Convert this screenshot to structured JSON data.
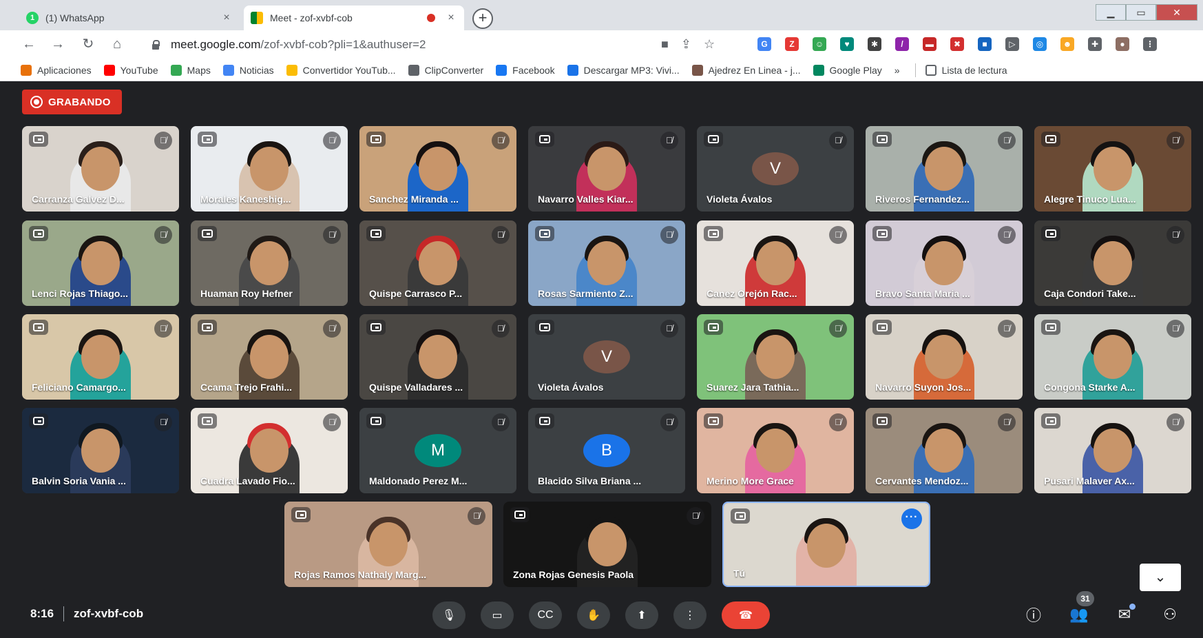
{
  "browser": {
    "tabs": [
      {
        "favicon_text": "1",
        "title": "(1) WhatsApp",
        "close": "×",
        "active": false
      },
      {
        "title": "Meet - zof-xvbf-cob",
        "close": "×",
        "active": true
      }
    ],
    "new_tab": "+",
    "window_controls": {
      "minimize": "▁",
      "maximize": "▭",
      "close": "✕"
    },
    "nav": {
      "back": "←",
      "forward": "→",
      "reload": "↻",
      "home": "⌂"
    },
    "url_host": "meet.google.com",
    "url_rest": "/zof-xvbf-cob?pli=1&authuser=2",
    "omni_icons": {
      "camera": "■",
      "share": "⇪",
      "star": "☆"
    },
    "extension_icons": [
      {
        "name": "ext-1",
        "text": "G",
        "color": "#4285f4"
      },
      {
        "name": "ext-2",
        "text": "Z",
        "color": "#e53935"
      },
      {
        "name": "ext-3",
        "text": "☺",
        "color": "#34a853"
      },
      {
        "name": "ext-4",
        "text": "♥",
        "color": "#00897b"
      },
      {
        "name": "ext-5",
        "text": "✱",
        "color": "#424242"
      },
      {
        "name": "ext-6",
        "text": "/",
        "color": "#8e24aa"
      },
      {
        "name": "ext-7",
        "text": "▬",
        "color": "#c62828"
      },
      {
        "name": "ext-8",
        "text": "✖",
        "color": "#d32f2f"
      },
      {
        "name": "ext-9",
        "text": "■",
        "color": "#1565c0"
      },
      {
        "name": "ext-10",
        "text": "▷",
        "color": "#5f6368"
      },
      {
        "name": "ext-11",
        "text": "◎",
        "color": "#1e88e5"
      },
      {
        "name": "ext-12",
        "text": "☻",
        "color": "#f9a825"
      },
      {
        "name": "ext-13",
        "text": "✚",
        "color": "#5f6368"
      },
      {
        "name": "ext-14",
        "text": "●",
        "color": "#8d6e63"
      },
      {
        "name": "ext-15",
        "text": "⋮",
        "color": "#5f6368"
      }
    ],
    "bookmarks": [
      {
        "label": "Aplicaciones",
        "color": "#e8710a"
      },
      {
        "label": "YouTube",
        "color": "#ff0000"
      },
      {
        "label": "Maps",
        "color": "#34a853"
      },
      {
        "label": "Noticias",
        "color": "#4285f4"
      },
      {
        "label": "Convertidor YouTub...",
        "color": "#fbbc04"
      },
      {
        "label": "ClipConverter",
        "color": "#5f6368"
      },
      {
        "label": "Facebook",
        "color": "#1877f2"
      },
      {
        "label": "Descargar MP3: Vivi...",
        "color": "#1a73e8"
      },
      {
        "label": "Ajedrez En Linea - j...",
        "color": "#795548"
      },
      {
        "label": "Google Play",
        "color": "#01875f"
      }
    ],
    "bookmarks_overflow": "»",
    "reading_list": "Lista de lectura"
  },
  "meet": {
    "recording_label": "GRABANDO",
    "participants": [
      {
        "name": "Carranza Galvez D...",
        "kind": "video",
        "muted": true,
        "bg": "#d9d3cc",
        "shirt": "#e8e8e8",
        "hair": "#2a1f1a"
      },
      {
        "name": "Morales Kaneshig...",
        "kind": "video",
        "muted": true,
        "bg": "#e9ecef",
        "shirt": "#d8c3b0",
        "hair": "#1a1512"
      },
      {
        "name": "Sanchez Miranda ...",
        "kind": "video",
        "muted": true,
        "bg": "#c9a27a",
        "shirt": "#1c66c8",
        "hair": "#151010"
      },
      {
        "name": "Navarro Valles Kiar...",
        "kind": "video",
        "muted": true,
        "bg": "#3a3b3e",
        "shirt": "#c2305a",
        "hair": "#2b1a16"
      },
      {
        "name": "Violeta Ávalos",
        "kind": "avatar",
        "letter": "V",
        "muted": true,
        "color": "#795548"
      },
      {
        "name": "Riveros Fernandez...",
        "kind": "video",
        "muted": true,
        "bg": "#a9b0aa",
        "shirt": "#3a6fb5",
        "hair": "#1b1713"
      },
      {
        "name": "Alegre Tinuco Lua...",
        "kind": "video",
        "muted": true,
        "bg": "#6a4a34",
        "shirt": "#b0d9c0",
        "hair": "#141212"
      },
      {
        "name": "Lenci Rojas Thiago...",
        "kind": "video",
        "muted": true,
        "bg": "#9aa88a",
        "shirt": "#2a4a8a",
        "hair": "#1a1512"
      },
      {
        "name": "Huaman Roy Hefner",
        "kind": "video",
        "muted": true,
        "bg": "#6e6a62",
        "shirt": "#4a4a4a",
        "hair": "#201a16"
      },
      {
        "name": "Quispe Carrasco P...",
        "kind": "video",
        "muted": true,
        "bg": "#56504a",
        "shirt": "#3a3a3a",
        "hair": "#c62828"
      },
      {
        "name": "Rosas Sarmiento Z...",
        "kind": "video",
        "muted": true,
        "bg": "#8aa6c7",
        "shirt": "#4b87c9",
        "hair": "#1a1512"
      },
      {
        "name": "Canez Orejón Rac...",
        "kind": "video",
        "muted": true,
        "bg": "#e6e1dc",
        "shirt": "#cf3a3a",
        "hair": "#1a1512"
      },
      {
        "name": "Bravo Santa Maria ...",
        "kind": "video",
        "muted": true,
        "bg": "#d2cbd6",
        "shirt": "#d8d0d8",
        "hair": "#141010"
      },
      {
        "name": "Caja Condori Take...",
        "kind": "video",
        "muted": true,
        "bg": "#3b3a38",
        "shirt": "#3a3a3a",
        "hair": "#141010"
      },
      {
        "name": "Feliciano Camargo...",
        "kind": "video",
        "muted": true,
        "bg": "#d8c7a8",
        "shirt": "#24a39b",
        "hair": "#1a1512"
      },
      {
        "name": "Ccama Trejo Frahi...",
        "kind": "video",
        "muted": true,
        "bg": "#b5a58a",
        "shirt": "#5a4a3a",
        "hair": "#181310"
      },
      {
        "name": "Quispe Valladares ...",
        "kind": "video",
        "muted": true,
        "bg": "#4a4743",
        "shirt": "#2d2d2d",
        "hair": "#151010"
      },
      {
        "name": "Violeta Ávalos",
        "kind": "avatar",
        "letter": "V",
        "muted": true,
        "color": "#795548"
      },
      {
        "name": "Suarez Jara Tathia...",
        "kind": "video",
        "muted": true,
        "bg": "#7fc27a",
        "shirt": "#7a6a5a",
        "hair": "#1a1512"
      },
      {
        "name": "Navarro Suyon Jos...",
        "kind": "video",
        "muted": true,
        "bg": "#d8d2c8",
        "shirt": "#d66a3a",
        "hair": "#161210"
      },
      {
        "name": "Congona Starke A...",
        "kind": "video",
        "muted": true,
        "bg": "#c9ccc7",
        "shirt": "#31a29b",
        "hair": "#1a1512"
      },
      {
        "name": "Balvin Soria Vania ...",
        "kind": "video",
        "muted": true,
        "bg": "#1b2a3f",
        "shirt": "#2a3a5a",
        "hair": "#101820"
      },
      {
        "name": "Cuadra Lavado Fio...",
        "kind": "video",
        "muted": true,
        "bg": "#ece7e0",
        "shirt": "#3a3a3a",
        "hair": "#d32f2f"
      },
      {
        "name": "Maldonado Perez M...",
        "kind": "avatar",
        "letter": "M",
        "muted": true,
        "color": "#00897b"
      },
      {
        "name": "Blacido Silva Briana ...",
        "kind": "avatar",
        "letter": "B",
        "muted": true,
        "color": "#1a73e8"
      },
      {
        "name": "Merino More Grace",
        "kind": "video",
        "muted": true,
        "bg": "#e0b5a0",
        "shirt": "#e56aa0",
        "hair": "#1a1512"
      },
      {
        "name": "Cervantes Mendoz...",
        "kind": "video",
        "muted": true,
        "bg": "#9b8c7c",
        "shirt": "#3a6fb5",
        "hair": "#1a1512"
      },
      {
        "name": "Pusari Malaver Ax...",
        "kind": "video",
        "muted": true,
        "bg": "#dcd7d0",
        "shirt": "#4a62a8",
        "hair": "#161210"
      },
      {
        "name": "Rojas Ramos Nathaly Marg...",
        "kind": "video",
        "muted": true,
        "bg": "#b99a84",
        "shirt": "#d8b6a0",
        "hair": "#4a3328"
      },
      {
        "name": "Zona Rojas Genesis Paola",
        "kind": "video",
        "muted": true,
        "bg": "#151515",
        "shirt": "#222222",
        "hair": "#151515"
      },
      {
        "name": "Tú",
        "kind": "self",
        "muted": false,
        "bg": "#dcd8cf",
        "shirt": "#e2b3a8",
        "hair": "#1a1512"
      }
    ],
    "scroll_down": "⌄",
    "time": "8:16",
    "meeting_code": "zof-xvbf-cob",
    "controls": [
      {
        "name": "microphone-button",
        "icon": "🎙"
      },
      {
        "name": "camera-button",
        "icon": "▭"
      },
      {
        "name": "captions-button",
        "icon": "CC"
      },
      {
        "name": "raise-hand-button",
        "icon": "✋"
      },
      {
        "name": "present-button",
        "icon": "⬆"
      },
      {
        "name": "more-options-button",
        "icon": "⋮"
      },
      {
        "name": "leave-call-button",
        "icon": "☎"
      }
    ],
    "participant_count": "31",
    "right_icons": {
      "info": "ⓘ",
      "people": "👥",
      "chat": "✉",
      "activities": "⚇"
    }
  }
}
